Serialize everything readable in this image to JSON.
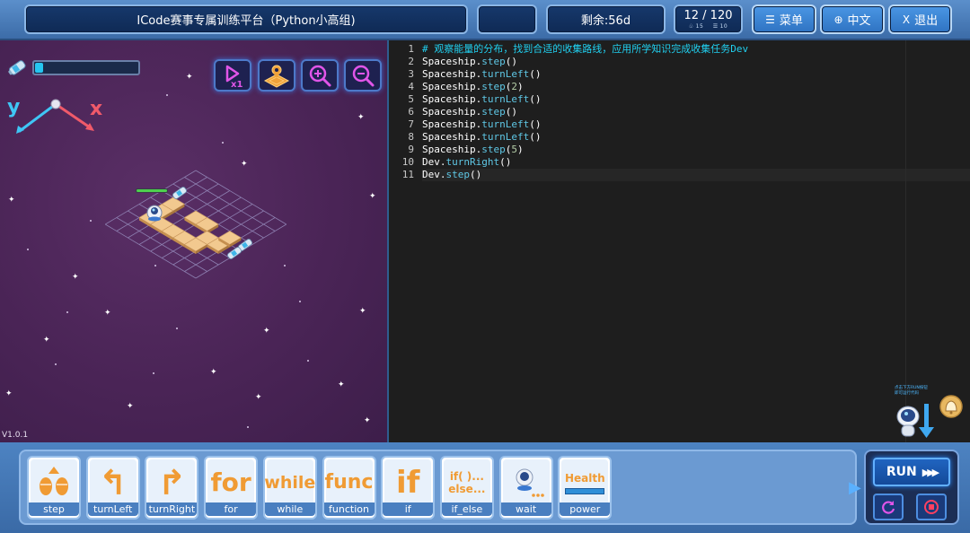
{
  "header": {
    "title": "ICode赛事专属训练平台（Python小高组)",
    "blank_slot": "",
    "remaining": "剩余:56d",
    "level": {
      "current": "12 / 120",
      "stat_a": "15",
      "stat_b": "10"
    },
    "menu_label": "菜单",
    "language_label": "中文",
    "exit_label": "退出",
    "exit_icon_char": "X"
  },
  "game": {
    "energy_fraction": 0.08,
    "axis_y": "y",
    "axis_x": "x",
    "version": "V1.0.1",
    "buttons": [
      "speed-x1",
      "map",
      "zoom-in",
      "zoom-out"
    ]
  },
  "editor": {
    "lines": [
      {
        "n": "1",
        "parts": [
          {
            "t": "# 观察能量的分布，找到合适的收集路线，应用所学知识完成收集任务Dev",
            "c": "cmt"
          }
        ]
      },
      {
        "n": "2",
        "parts": [
          {
            "t": "Spaceship.",
            "c": ""
          },
          {
            "t": "step",
            "c": "meth"
          },
          {
            "t": "()",
            "c": ""
          }
        ]
      },
      {
        "n": "3",
        "parts": [
          {
            "t": "Spaceship.",
            "c": ""
          },
          {
            "t": "turnLeft",
            "c": "meth"
          },
          {
            "t": "()",
            "c": ""
          }
        ]
      },
      {
        "n": "4",
        "parts": [
          {
            "t": "Spaceship.",
            "c": ""
          },
          {
            "t": "step",
            "c": "meth"
          },
          {
            "t": "(",
            "c": ""
          },
          {
            "t": "2",
            "c": "num"
          },
          {
            "t": ")",
            "c": ""
          }
        ]
      },
      {
        "n": "5",
        "parts": [
          {
            "t": "Spaceship.",
            "c": ""
          },
          {
            "t": "turnLeft",
            "c": "meth"
          },
          {
            "t": "()",
            "c": ""
          }
        ]
      },
      {
        "n": "6",
        "parts": [
          {
            "t": "Spaceship.",
            "c": ""
          },
          {
            "t": "step",
            "c": "meth"
          },
          {
            "t": "()",
            "c": ""
          }
        ]
      },
      {
        "n": "7",
        "parts": [
          {
            "t": "Spaceship.",
            "c": ""
          },
          {
            "t": "turnLeft",
            "c": "meth"
          },
          {
            "t": "()",
            "c": ""
          }
        ]
      },
      {
        "n": "8",
        "parts": [
          {
            "t": "Spaceship.",
            "c": ""
          },
          {
            "t": "turnLeft",
            "c": "meth"
          },
          {
            "t": "()",
            "c": ""
          }
        ]
      },
      {
        "n": "9",
        "parts": [
          {
            "t": "Spaceship.",
            "c": ""
          },
          {
            "t": "step",
            "c": "meth"
          },
          {
            "t": "(",
            "c": ""
          },
          {
            "t": "5",
            "c": "num"
          },
          {
            "t": ")",
            "c": ""
          }
        ]
      },
      {
        "n": "10",
        "parts": [
          {
            "t": "Dev.",
            "c": ""
          },
          {
            "t": "turnRight",
            "c": "meth"
          },
          {
            "t": "()",
            "c": ""
          }
        ]
      },
      {
        "n": "11",
        "parts": [
          {
            "t": "Dev.",
            "c": ""
          },
          {
            "t": "step",
            "c": "meth"
          },
          {
            "t": "()",
            "c": ""
          }
        ]
      }
    ],
    "help_text": [
      "点击下方RUN按钮",
      "即可运行代码"
    ]
  },
  "palette": {
    "blocks": [
      {
        "label": "step",
        "glyph": "",
        "icon": "footsteps-icon"
      },
      {
        "label": "turnLeft",
        "glyph": "↰",
        "icon": "turn-left-icon"
      },
      {
        "label": "turnRight",
        "glyph": "↱",
        "icon": "turn-right-icon"
      },
      {
        "label": "for",
        "glyph": "for",
        "icon": "for-icon"
      },
      {
        "label": "while",
        "glyph": "while",
        "icon": "while-icon"
      },
      {
        "label": "function",
        "glyph": "func",
        "icon": "func-icon"
      },
      {
        "label": "if",
        "glyph": "if",
        "icon": "if-icon"
      },
      {
        "label": "if_else",
        "glyph": "if( )...else...",
        "icon": "if-else-icon"
      },
      {
        "label": "wait",
        "glyph": "",
        "icon": "robot-wait-icon"
      },
      {
        "label": "power",
        "glyph": "Health",
        "icon": "health-bar-icon"
      }
    ]
  },
  "run": {
    "label": "RUN"
  },
  "colors": {
    "accent": "#f09b34",
    "code_comment": "#20d0f0",
    "code_method": "#5fc8e6",
    "energy": "#25c6f0"
  }
}
